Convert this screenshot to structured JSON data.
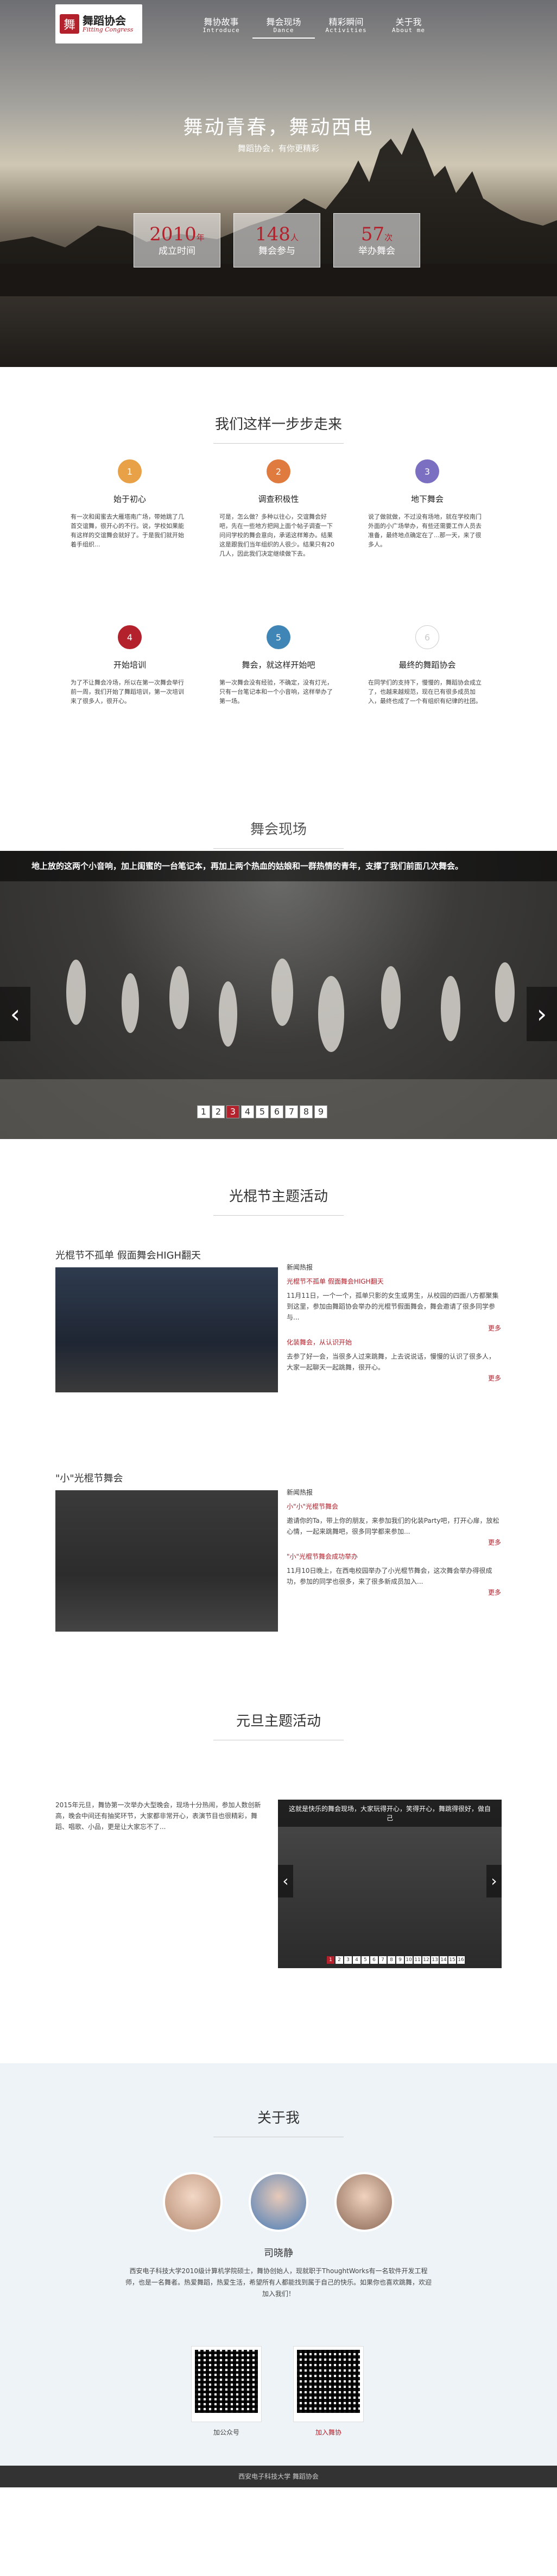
{
  "brand": {
    "mark": "舞",
    "cn": "舞蹈协会",
    "en": "Fitting Congress"
  },
  "menu": [
    {
      "cn": "舞协故事",
      "en": "Introduce"
    },
    {
      "cn": "舞会现场",
      "en": "Dance"
    },
    {
      "cn": "精彩瞬间",
      "en": "Activities"
    },
    {
      "cn": "关于我",
      "en": "About me"
    }
  ],
  "hero": {
    "title": "舞动青春，舞动西电",
    "subtitle": "舞蹈协会，有你更精彩",
    "stats": [
      {
        "num": "2010",
        "unit": "年",
        "label": "成立时间"
      },
      {
        "num": "148",
        "unit": "人",
        "label": "舞会参与"
      },
      {
        "num": "57",
        "unit": "次",
        "label": "举办舞会"
      }
    ]
  },
  "steps": {
    "title": "我们这样一步步走来",
    "items": [
      {
        "n": "1",
        "color": "#e8a146",
        "title": "始于初心",
        "desc": "有一次和闺蜜去大雁塔南广场，带她跳了几首交谊舞，很开心的不行。说，学校如果能有这样的交谊舞会就好了。于是我们就开始着手组织..."
      },
      {
        "n": "2",
        "color": "#e07b3f",
        "title": "调查积极性",
        "desc": "可是，怎么做？多种以往心，交谊舞会好吧，先在一些地方把网上面个帖子调查一下问问学校的舞会意向，承诺这样筹办。结果这是跟我们当年组织的人很少。结果只有20几人，因此我们决定继续做下去。"
      },
      {
        "n": "3",
        "color": "#7a6fc0",
        "title": "地下舞会",
        "desc": "说了做就做，不过没有场地，就在学校南门外面的小广场举办，有些还需要工作人员去准备，最终地点确定在了...那一天，来了很多人。"
      },
      {
        "n": "4",
        "color": "#b3212c",
        "title": "开始培训",
        "desc": "为了不让舞会冷场，所以在第一次舞会举行前一周，我们开始了舞蹈培训，第一次培训来了很多人，很开心。"
      },
      {
        "n": "5",
        "color": "#3f86b7",
        "title": "舞会，就这样开始吧",
        "desc": "第一次舞会没有经验，不确定，没有灯光，只有一台笔记本和一个小音响，这样举办了第一场。"
      },
      {
        "n": "6",
        "color": "#ffffff",
        "title": "最终的舞蹈协会",
        "desc": "在同学们的支持下，慢慢的，舞蹈协会成立了，也越来越规范，现在已有很多成员加入，最终也成了一个有组织有纪律的社团。"
      }
    ]
  },
  "live": {
    "title": "舞会现场",
    "caption": "地上放的这两个小音响，加上闺蜜的一台笔记本，再加上两个热血的姑娘和一群热情的青年，支撑了我们前面几次舞会。",
    "pages": [
      "1",
      "2",
      "3",
      "4",
      "5",
      "6",
      "7",
      "8",
      "9"
    ],
    "active_page": 3
  },
  "singles": {
    "title": "光棍节主题活动",
    "article1": {
      "head": "光棍节不孤单  假面舞会HIGH翻天",
      "news_label": "新闻热报",
      "news_title": "光棍节不孤单 假面舞会HIGH翻天",
      "news_body": "11月11日，一个一个，孤单只影的女生或男生，从校园的四面八方都聚集到这里，参加由舞蹈协会举办的光棍节假面舞会，舞会邀请了很多同学参与...",
      "more": "更多",
      "news_title2": "化装舞会，从认识开始",
      "news_body2": "去参了好一会，当很多人过来跳舞，上去说说话，慢慢的认识了很多人，大家一起聊天一起跳舞，很开心。",
      "more2": "更多"
    },
    "article2": {
      "head": "\"小\"光棍节舞会",
      "news_label": "新闻热报",
      "news_title": "小\"小\"光棍节舞会",
      "news_body": "邀请你的Ta，带上你的朋友，来参加我们的化装Party吧，打开心扉，放松心情，一起来跳舞吧，很多同学都来参加...",
      "more": "更多",
      "news_title2": "\"小\"光棍节舞会成功举办",
      "news_body2": "11月10日晚上，在西电校园举办了小光棍节舞会，这次舞会举办得很成功，参加的同学也很多，来了很多新成员加入...",
      "more2": "更多"
    }
  },
  "newyear": {
    "title": "元旦主题活动",
    "body": "2015年元旦，舞协第一次举办大型晚会，现场十分热闹，参加人数创新高，晚会中间还有抽奖环节，大家都非常开心，表演节目也很精彩，舞蹈、唱歌、小品，更是让大家忘不了...",
    "caption": "这就是快乐的舞会现场，大家玩得开心，笑得开心，舞跳得很好，做自己",
    "pages": [
      "1",
      "2",
      "3",
      "4",
      "5",
      "6",
      "7",
      "8",
      "9",
      "10",
      "11",
      "12",
      "13",
      "14",
      "15",
      "16"
    ]
  },
  "about": {
    "title": "关于我",
    "name": "司晓静",
    "bio": "西安电子科技大学2010级计算机学院硕士，舞协创始人，现就职于ThoughtWorks有一名软件开发工程师，也是一名舞者。热爱舞蹈，热爱生活，希望所有人都能找到属于自己的快乐。如果你也喜欢跳舞，欢迎加入我们！",
    "qr1": "加公众号",
    "qr2": "加入舞协"
  },
  "footer": "西安电子科技大学  舞蹈协会"
}
